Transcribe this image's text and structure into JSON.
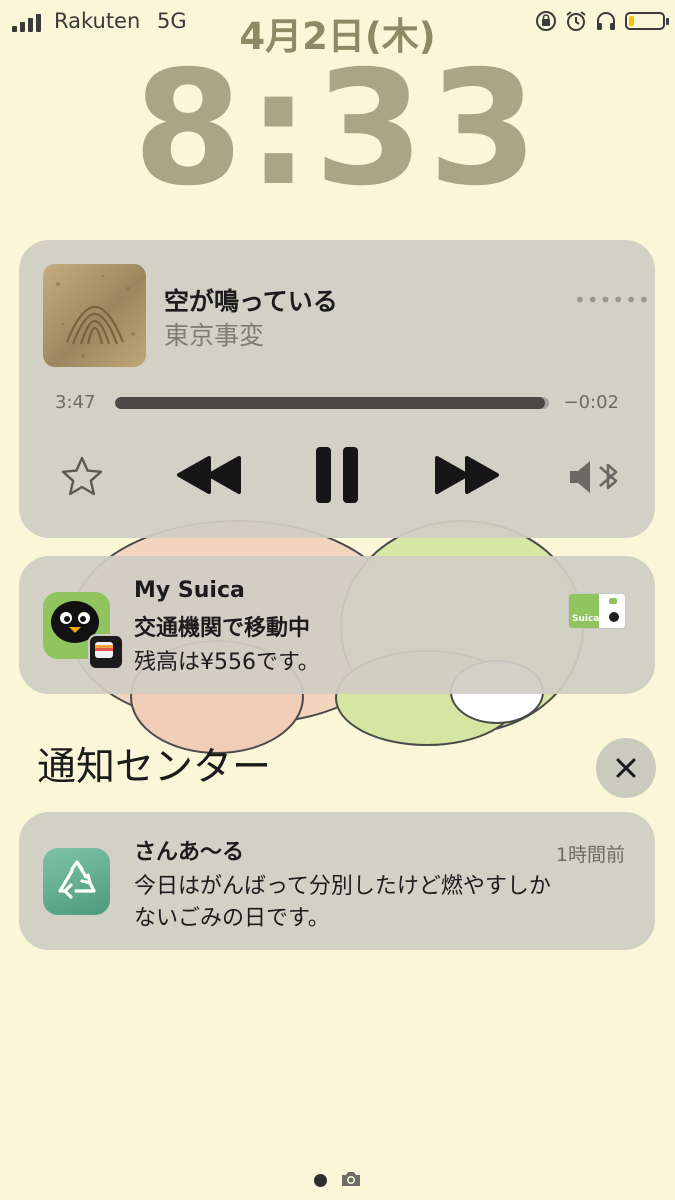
{
  "status_bar": {
    "carrier": "Rakuten",
    "network": "5G",
    "date": "4月2日(木)",
    "icons": [
      "orientation-lock-icon",
      "alarm-icon",
      "headphones-icon",
      "battery-icon"
    ],
    "battery_level": 0.15,
    "battery_color": "#f1c500"
  },
  "lock_screen": {
    "time": "8:33"
  },
  "now_playing": {
    "title": "空が鳴っている",
    "artist": "東京事変",
    "elapsed": "3:47",
    "remaining": "−0:02",
    "progress": 0.99,
    "controls": [
      "star-icon",
      "rewind-icon",
      "pause-icon",
      "fast-forward-icon",
      "bluetooth-speaker-icon"
    ]
  },
  "suica_notification": {
    "app": "My Suica",
    "title": "交通機関で移動中",
    "body": "残高は¥556です。",
    "card_label": "Suica"
  },
  "notification_center": {
    "title": "通知センター",
    "close_icon": "close-icon"
  },
  "sanaru_notification": {
    "app": "さんあ〜る",
    "time": "1時間前",
    "body_line1": "今日はがんばって分別したけど燃やすしか",
    "body_line2": "ないごみの日です。"
  },
  "page_indicator": {
    "current": 1,
    "icons": [
      "page-dot",
      "camera-icon"
    ]
  }
}
